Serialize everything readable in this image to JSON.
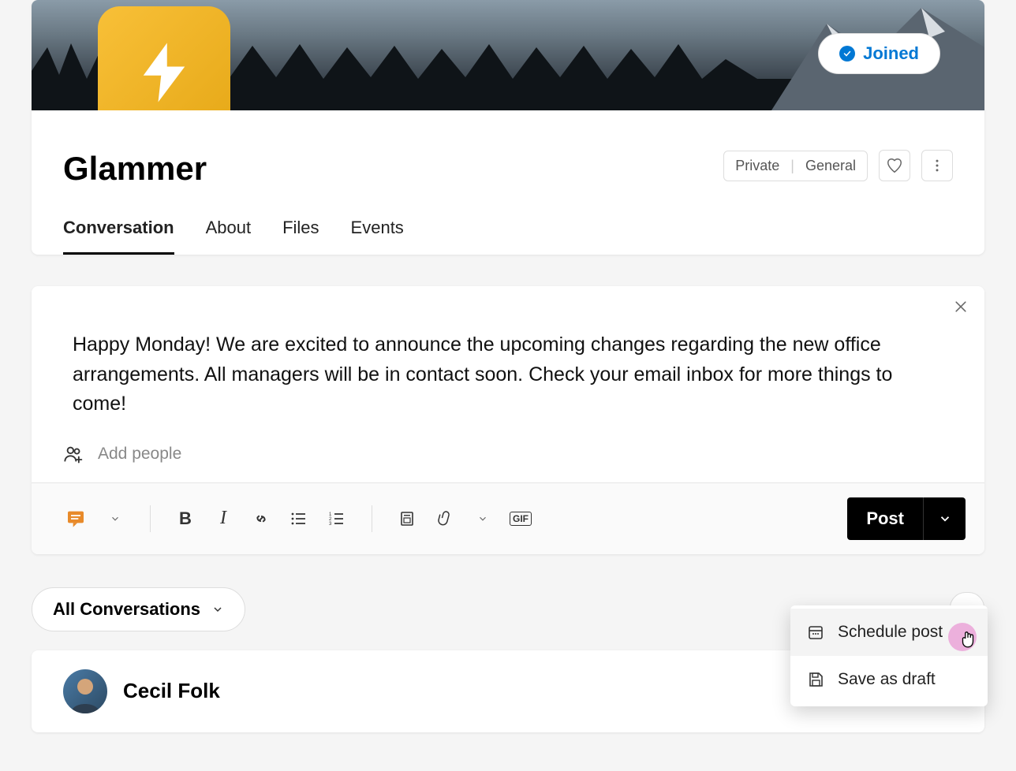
{
  "header": {
    "community_name": "Glammer",
    "joined_label": "Joined",
    "tags": {
      "privacy": "Private",
      "type": "General"
    }
  },
  "tabs": [
    {
      "label": "Conversation",
      "active": true
    },
    {
      "label": "About",
      "active": false
    },
    {
      "label": "Files",
      "active": false
    },
    {
      "label": "Events",
      "active": false
    }
  ],
  "composer": {
    "text": "Happy Monday! We are excited to announce the upcoming changes regarding the new office arrangements. All managers will be in contact soon. Check your email inbox for more things to come!",
    "add_people_placeholder": "Add people",
    "post_button": "Post",
    "gif_label": "GIF"
  },
  "post_menu": {
    "schedule": "Schedule post",
    "draft": "Save as draft"
  },
  "filters": {
    "all_conversations": "All Conversations"
  },
  "feed": {
    "first_author": "Cecil Folk"
  }
}
